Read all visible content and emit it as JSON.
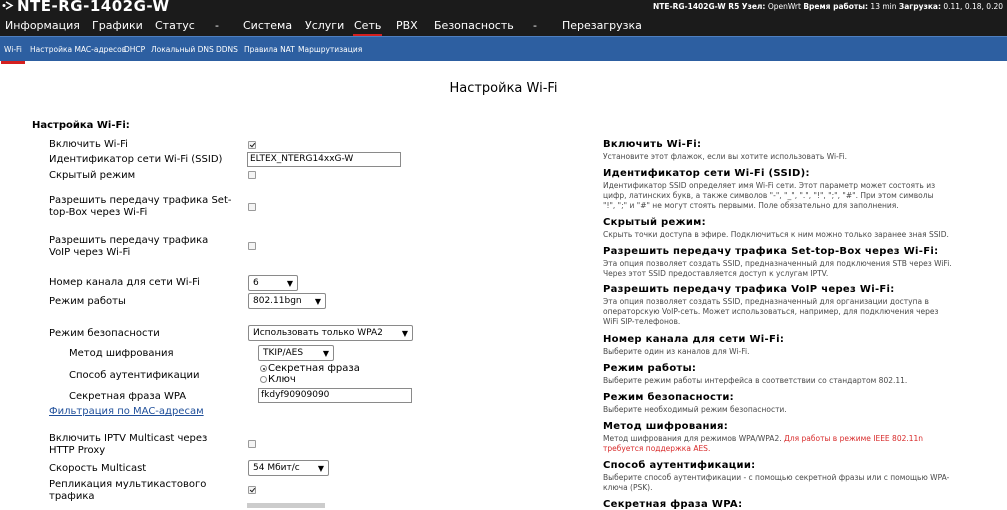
{
  "header": {
    "brand": "NTE-RG-1402G-W",
    "sysinfo": {
      "model": "NTE-RG-1402G-W R5",
      "node_label": "Узел:",
      "node": "OpenWrt",
      "uptime_label": "Время работы:",
      "uptime": "13 min",
      "load_label": "Загрузка:",
      "load": "0.11, 0.18, 0.20"
    }
  },
  "menu": [
    "Информация",
    "Графики",
    "Статус",
    "-",
    "Система",
    "Услуги",
    "Сеть",
    "PBX",
    "Безопасность",
    "-",
    "Перезагрузка"
  ],
  "submenu": [
    "Wi-Fi",
    "Настройка MAC-адресов",
    "DHCP",
    "Локальный DNS",
    "DDNS",
    "Правила NAT",
    "Маршрутизация"
  ],
  "page": {
    "title": "Настройка Wi-Fi",
    "section": "Настройка Wi-Fi:"
  },
  "form": {
    "enable_label": "Включить Wi-Fi",
    "ssid_label": "Идентификатор сети Wi-Fi (SSID)",
    "ssid_value": "ELTEX_NTERG14xxG-W",
    "hidden_label": "Скрытый режим",
    "stb_label_1": "Разрешить передачу трафика Set-",
    "stb_label_2": "top-Box через Wi-Fi",
    "voip_label_1": "Разрешить передачу трафика",
    "voip_label_2": "VoIP через Wi-Fi",
    "channel_label": "Номер канала для сети Wi-Fi",
    "channel_value": "6",
    "mode_label": "Режим работы",
    "mode_value": "802.11bgn",
    "security_label": "Режим безопасности",
    "security_value": "Использовать только WPA2",
    "cipher_label": "Метод шифрования",
    "cipher_value": "TKIP/AES",
    "auth_label": "Способ аутентификации",
    "auth_option_1": "Секретная фраза",
    "auth_option_2": "Ключ",
    "wpa_label": "Секретная фраза WPA",
    "wpa_value": "fkdyf90909090",
    "mac_filter_link": "Фильтрация по MAC-адресам",
    "iptv_label_1": "Включить IPTV Multicast через",
    "iptv_label_2": "HTTP Proxy",
    "multicast_speed_label": "Скорость Multicast",
    "multicast_speed_value": "54 Мбит/с",
    "replication_label_1": "Репликация мультикастового",
    "replication_label_2": "трафика"
  },
  "state": {
    "enable_wifi": true,
    "hidden_mode": false,
    "stb": false,
    "voip": false,
    "auth_passphrase_selected": true,
    "iptv_multicast": false,
    "replication": true
  },
  "help": [
    {
      "title": "Включить Wi-Fi:",
      "lines": [
        "Установите этот флажок, если вы хотите использовать Wi-Fi."
      ]
    },
    {
      "title": "Идентификатор сети Wi-Fi (SSID):",
      "lines": [
        "Идентификатор SSID определяет имя Wi-Fi сети. Этот параметр может состоять из",
        "цифр, латинских букв, а также символов \"-\", \"_\", \".\", \"!\", \";\", \"#\". При этом символы",
        "\"!\", \";\" и \"#\" не могут стоять первыми. Поле обязательно для заполнения."
      ]
    },
    {
      "title": "Скрытый режим:",
      "lines": [
        "Скрыть точки доступа в эфире. Подключиться к ним можно только заранее зная SSID."
      ]
    },
    {
      "title": "Разрешить передачу трафика Set-top-Box через Wi-Fi:",
      "lines": [
        "Эта опция позволяет создать SSID, предназначенный для подключения STB через WiFi.",
        "Через этот SSID предоставляется доступ к услугам IPTV."
      ]
    },
    {
      "title": "Разрешить передачу трафика VoIP через Wi-Fi:",
      "lines": [
        "Эта опция позволяет создать SSID, предназначенный для организации доступа в",
        "операторскую VoIP-сеть. Может использоваться, например, для подключения через",
        "WiFi SIP-телефонов."
      ]
    },
    {
      "title": "Номер канала для сети Wi-Fi:",
      "lines": [
        "Выберите один из каналов для Wi-Fi."
      ]
    },
    {
      "title": "Режим работы:",
      "lines": [
        "Выберите режим работы интерфейса в соответствии со стандартом 802.11."
      ]
    },
    {
      "title": "Режим безопасности:",
      "lines": [
        "Выберите необходимый режим безопасности."
      ]
    },
    {
      "title": "Метод шифрования:",
      "lines": [
        "Метод шифрования для режимов WPA/WPA2.",
        "требуется поддержка AES."
      ],
      "red_a": "Для работы в режиме IEEE 802.11n"
    },
    {
      "title": "Способ аутентификации:",
      "lines": [
        "Выберите способ аутентификации - с помощью секретной фразы или с помощью WPA-",
        "ключа (PSK)."
      ]
    },
    {
      "title": "Секретная фраза WPA:",
      "lines": []
    }
  ],
  "colors": {
    "topbar": "#1b1b1b",
    "subbar": "#2d5fa1",
    "active_underline": "#d41f1f",
    "help_red": "#d82b2b",
    "link": "#1f4f9a"
  },
  "icons": {
    "logo": "eltex-logo-icon",
    "checkbox": "checkbox-icon",
    "dropdown": "chevron-down-icon"
  }
}
